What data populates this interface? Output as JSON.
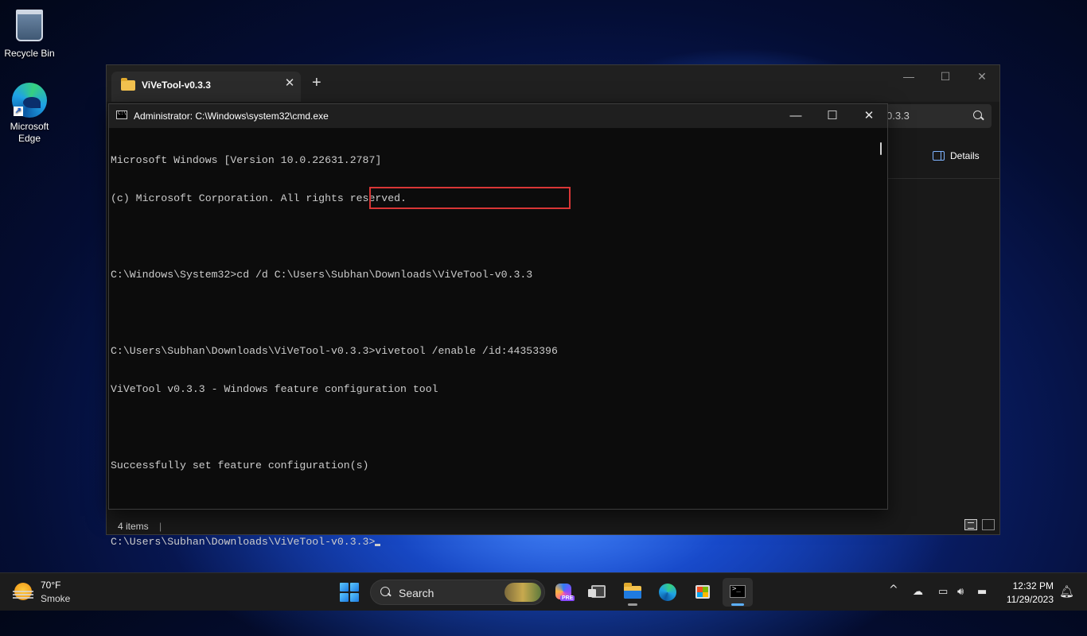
{
  "desktop": {
    "icons": [
      {
        "label": "Recycle Bin"
      },
      {
        "label": "Microsoft Edge"
      }
    ]
  },
  "explorer": {
    "tab_title": "ViVeTool-v0.3.3",
    "tab_close": "✕",
    "new_tab": "+",
    "minimize": "—",
    "maximize": "☐",
    "close": "✕",
    "address_fragment": "0.3.3",
    "details_label": "Details",
    "status_items": "4 items",
    "status_separator": "|"
  },
  "cmd": {
    "title": "Administrator: C:\\Windows\\system32\\cmd.exe",
    "minimize": "—",
    "maximize": "☐",
    "close": "✕",
    "lines": [
      "Microsoft Windows [Version 10.0.22631.2787]",
      "(c) Microsoft Corporation. All rights reserved.",
      "",
      "C:\\Windows\\System32>cd /d C:\\Users\\Subhan\\Downloads\\ViVeTool-v0.3.3",
      "",
      "C:\\Users\\Subhan\\Downloads\\ViVeTool-v0.3.3>vivetool /enable /id:44353396",
      "ViVeTool v0.3.3 - Windows feature configuration tool",
      "",
      "Successfully set feature configuration(s)",
      ""
    ],
    "prompt": "C:\\Users\\Subhan\\Downloads\\ViVeTool-v0.3.3>"
  },
  "taskbar": {
    "weather_temp": "70°F",
    "weather_condition": "Smoke",
    "search_label": "Search",
    "copilot_badge": "PRE",
    "tray_chevron": "^",
    "time": "12:32 PM",
    "date": "11/29/2023"
  },
  "colors": {
    "highlight_box": "#d93636",
    "console_text": "#cccccc",
    "console_bg": "#0c0c0c"
  }
}
